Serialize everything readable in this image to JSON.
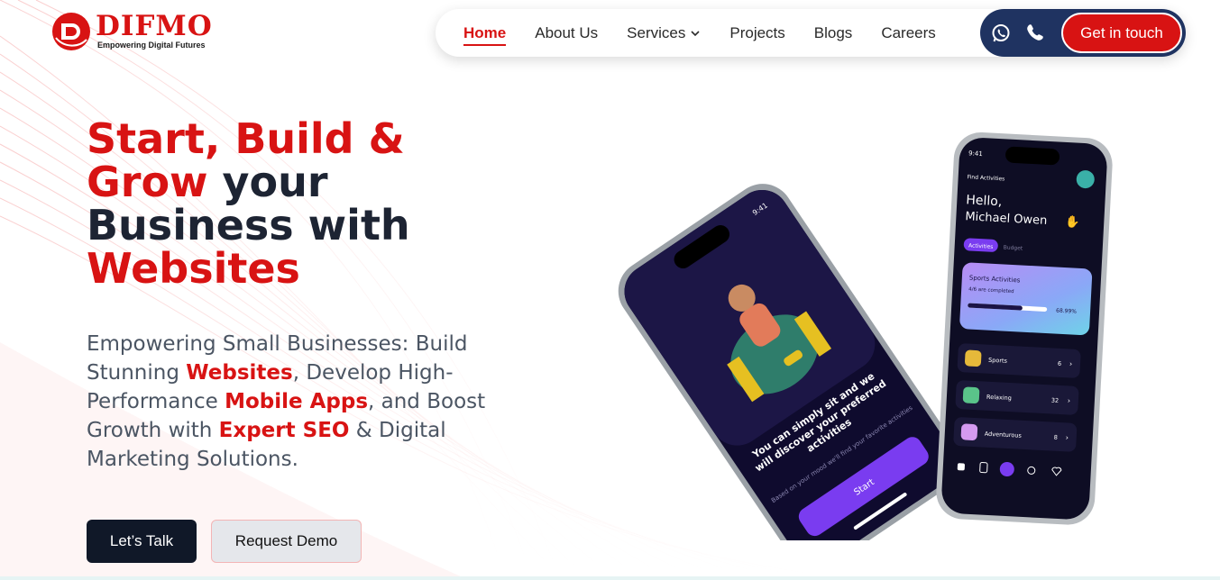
{
  "brand": {
    "name": "DIFMO",
    "tagline": "Empowering Digital Futures",
    "color": "#d81313"
  },
  "nav": {
    "items": [
      {
        "label": "Home",
        "active": true
      },
      {
        "label": "About Us"
      },
      {
        "label": "Services",
        "icon": "chevron-down-icon"
      },
      {
        "label": "Projects"
      },
      {
        "label": "Blogs"
      },
      {
        "label": "Careers"
      }
    ],
    "whatsapp_icon": "whatsapp-icon",
    "phone_icon": "phone-icon",
    "cta_label": "Get in touch"
  },
  "hero": {
    "title_red_1": "Start, Build &",
    "title_red_2": "Grow",
    "title_dark_1": " your",
    "title_dark_2": "Business with",
    "title_red_3": "Websites",
    "sub_1": "Empowering Small Businesses: Build Stunning ",
    "sub_hl_1": "Websites",
    "sub_2": ", Develop High-Performance ",
    "sub_hl_2": "Mobile Apps",
    "sub_3": ", and Boost Growth with ",
    "sub_hl_3": "Expert SEO",
    "sub_4": " & Digital Marketing Solutions.",
    "btn_primary": "Let’s Talk",
    "btn_secondary": "Request Demo"
  },
  "phone_left": {
    "time": "9:41",
    "text_main": "You can simply sit and we will discover your preferred activities",
    "text_small": "Based on your mood we'll find your favorite activities",
    "button": "Start"
  },
  "phone_right": {
    "time": "9:41",
    "header": "Find Activities",
    "greeting": "Hello,",
    "name": "Michael Owen",
    "tab_active": "Activities",
    "tab_other": "Budget",
    "card_title": "Sports Activities",
    "card_sub": "4/6 are completed",
    "progress_label": "68.99%",
    "progress": 0.69,
    "items": [
      {
        "label": "Sports",
        "count": "6"
      },
      {
        "label": "Relaxing",
        "count": "32"
      },
      {
        "label": "Adventurous",
        "count": "8"
      }
    ]
  },
  "colors": {
    "accent": "#d81313",
    "dark": "#1d2433",
    "navy": "#1f3361"
  }
}
